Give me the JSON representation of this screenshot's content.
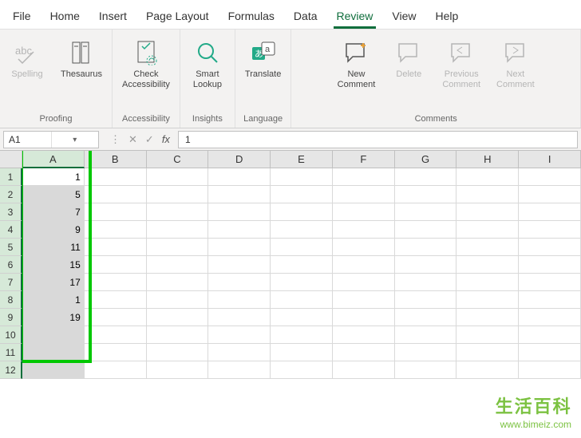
{
  "tabs": {
    "file": "File",
    "home": "Home",
    "insert": "Insert",
    "page_layout": "Page Layout",
    "formulas": "Formulas",
    "data": "Data",
    "review": "Review",
    "view": "View",
    "help": "Help",
    "active": "review"
  },
  "ribbon": {
    "proofing": {
      "label": "Proofing",
      "spelling": "Spelling",
      "thesaurus": "Thesaurus"
    },
    "accessibility": {
      "label": "Accessibility",
      "check": "Check\nAccessibility"
    },
    "insights": {
      "label": "Insights",
      "smart": "Smart\nLookup"
    },
    "language": {
      "label": "Language",
      "translate": "Translate"
    },
    "comments": {
      "label": "Comments",
      "new": "New\nComment",
      "delete": "Delete",
      "previous": "Previous\nComment",
      "next": "Next\nComment"
    }
  },
  "formula_bar": {
    "name_box": "A1",
    "fx": "fx",
    "value": "1"
  },
  "grid": {
    "columns": [
      "A",
      "B",
      "C",
      "D",
      "E",
      "F",
      "G",
      "H",
      "I"
    ],
    "selected_column": "A",
    "row_count": 12,
    "cells": {
      "A1": "1",
      "A2": "5",
      "A3": "7",
      "A4": "9",
      "A5": "11",
      "A6": "15",
      "A7": "17",
      "A8": "1",
      "A9": "19"
    }
  },
  "watermark": {
    "cn": "生活百科",
    "url": "www.bimeiz.com"
  }
}
